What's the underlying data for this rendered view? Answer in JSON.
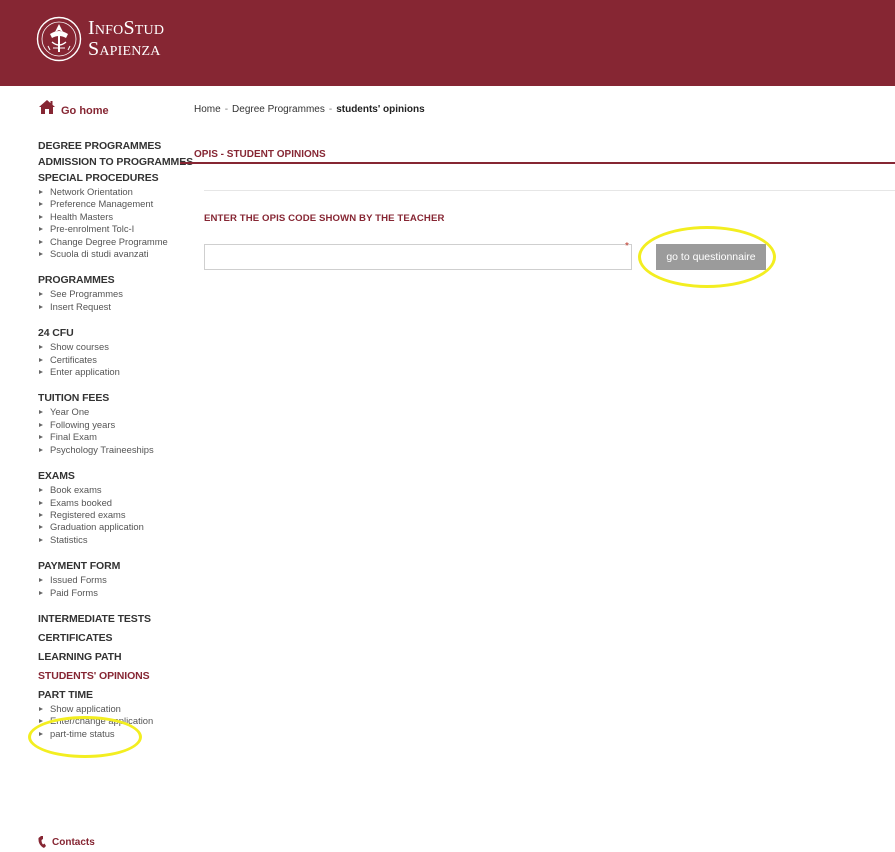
{
  "header": {
    "brand_line1": "InfoStud",
    "brand_line2": "Sapienza",
    "bg_color": "#862633"
  },
  "sidebar": {
    "go_home": "Go home",
    "sections": [
      {
        "title": "DEGREE PROGRAMMES",
        "items": []
      },
      {
        "title": "ADMISSION TO PROGRAMMES",
        "items": []
      },
      {
        "title": "SPECIAL PROCEDURES",
        "items": [
          "Network Orientation",
          "Preference Management",
          "Health Masters",
          "Pre-enrolment Tolc-I",
          "Change Degree Programme",
          "Scuola di studi avanzati"
        ]
      },
      {
        "title": "PROGRAMMES",
        "items": [
          "See Programmes",
          "Insert Request"
        ]
      },
      {
        "title": "24 CFU",
        "items": [
          "Show courses",
          "Certificates",
          "Enter application"
        ]
      },
      {
        "title": "TUITION FEES",
        "items": [
          "Year One",
          "Following years",
          "Final Exam",
          "Psychology Traineeships"
        ]
      },
      {
        "title": "EXAMS",
        "items": [
          "Book exams",
          "Exams booked",
          "Registered exams",
          "Graduation application",
          "Statistics"
        ]
      },
      {
        "title": "PAYMENT FORM",
        "items": [
          "Issued Forms",
          "Paid Forms"
        ]
      },
      {
        "title": "INTERMEDIATE TESTS",
        "items": []
      },
      {
        "title": "CERTIFICATES",
        "items": []
      },
      {
        "title": "LEARNING PATH",
        "items": []
      },
      {
        "title": "STUDENTS' OPINIONS",
        "items": []
      },
      {
        "title": "PART TIME",
        "items": [
          "Show application",
          "Enter/change application",
          "part-time status"
        ]
      }
    ],
    "contacts": "Contacts"
  },
  "breadcrumb": {
    "home": "Home",
    "sep": "-",
    "degree": "Degree Programmes",
    "current": "students' opinions"
  },
  "main": {
    "title": "OPIS - STUDENT OPINIONS",
    "form_label": "ENTER THE OPIS CODE SHOWN BY THE TEACHER",
    "input_value": "",
    "required_mark": "*",
    "button_label": "go to questionnaire"
  },
  "highlight_color": "#f3ee20"
}
